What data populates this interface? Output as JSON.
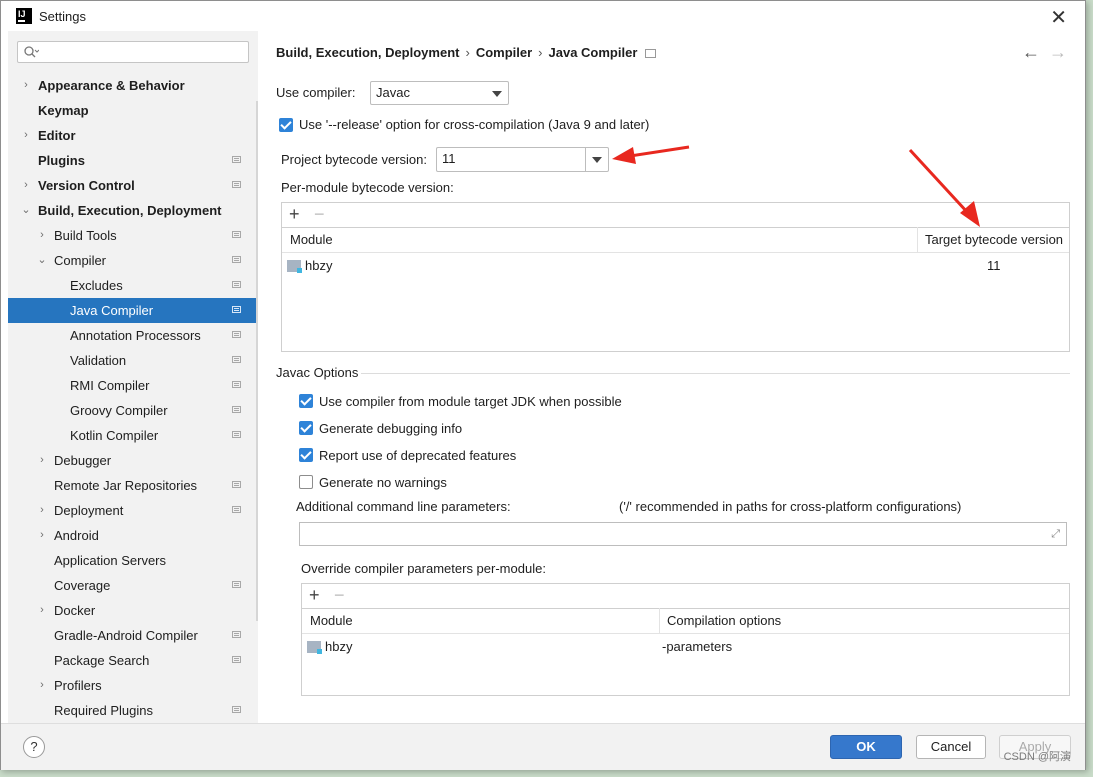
{
  "window": {
    "title": "Settings"
  },
  "sidebar": {
    "search_placeholder": "",
    "items": [
      {
        "label": "Appearance & Behavior",
        "bold": true,
        "arrow": "right",
        "indent": 0,
        "proj": false
      },
      {
        "label": "Keymap",
        "bold": true,
        "arrow": "",
        "indent": 0,
        "proj": false
      },
      {
        "label": "Editor",
        "bold": true,
        "arrow": "right",
        "indent": 0,
        "proj": false
      },
      {
        "label": "Plugins",
        "bold": true,
        "arrow": "",
        "indent": 0,
        "proj": true
      },
      {
        "label": "Version Control",
        "bold": true,
        "arrow": "right",
        "indent": 0,
        "proj": true
      },
      {
        "label": "Build, Execution, Deployment",
        "bold": true,
        "arrow": "down",
        "indent": 0,
        "proj": false
      },
      {
        "label": "Build Tools",
        "bold": false,
        "arrow": "right",
        "indent": 1,
        "proj": true
      },
      {
        "label": "Compiler",
        "bold": false,
        "arrow": "down",
        "indent": 1,
        "proj": true
      },
      {
        "label": "Excludes",
        "bold": false,
        "arrow": "",
        "indent": 2,
        "proj": true
      },
      {
        "label": "Java Compiler",
        "bold": false,
        "arrow": "",
        "indent": 2,
        "proj": true,
        "selected": true
      },
      {
        "label": "Annotation Processors",
        "bold": false,
        "arrow": "",
        "indent": 2,
        "proj": true
      },
      {
        "label": "Validation",
        "bold": false,
        "arrow": "",
        "indent": 2,
        "proj": true
      },
      {
        "label": "RMI Compiler",
        "bold": false,
        "arrow": "",
        "indent": 2,
        "proj": true
      },
      {
        "label": "Groovy Compiler",
        "bold": false,
        "arrow": "",
        "indent": 2,
        "proj": true
      },
      {
        "label": "Kotlin Compiler",
        "bold": false,
        "arrow": "",
        "indent": 2,
        "proj": true
      },
      {
        "label": "Debugger",
        "bold": false,
        "arrow": "right",
        "indent": 1,
        "proj": false
      },
      {
        "label": "Remote Jar Repositories",
        "bold": false,
        "arrow": "",
        "indent": 1,
        "proj": true
      },
      {
        "label": "Deployment",
        "bold": false,
        "arrow": "right",
        "indent": 1,
        "proj": true
      },
      {
        "label": "Android",
        "bold": false,
        "arrow": "right",
        "indent": 1,
        "proj": false
      },
      {
        "label": "Application Servers",
        "bold": false,
        "arrow": "",
        "indent": 1,
        "proj": false
      },
      {
        "label": "Coverage",
        "bold": false,
        "arrow": "",
        "indent": 1,
        "proj": true
      },
      {
        "label": "Docker",
        "bold": false,
        "arrow": "right",
        "indent": 1,
        "proj": false
      },
      {
        "label": "Gradle-Android Compiler",
        "bold": false,
        "arrow": "",
        "indent": 1,
        "proj": true
      },
      {
        "label": "Package Search",
        "bold": false,
        "arrow": "",
        "indent": 1,
        "proj": true
      },
      {
        "label": "Profilers",
        "bold": false,
        "arrow": "right",
        "indent": 1,
        "proj": false
      },
      {
        "label": "Required Plugins",
        "bold": false,
        "arrow": "",
        "indent": 1,
        "proj": true
      }
    ]
  },
  "breadcrumb": [
    "Build, Execution, Deployment",
    "Compiler",
    "Java Compiler"
  ],
  "main": {
    "use_compiler_label": "Use compiler:",
    "use_compiler_value": "Javac",
    "release_option_label": "Use '--release' option for cross-compilation (Java 9 and later)",
    "project_bytecode_label": "Project bytecode version:",
    "project_bytecode_value": "11",
    "per_module_label": "Per-module bytecode version:",
    "module_table": {
      "col_module": "Module",
      "col_target": "Target bytecode version",
      "rows": [
        {
          "module": "hbzy",
          "target": "11"
        }
      ]
    },
    "javac_options_label": "Javac Options",
    "opt_module_jdk": "Use compiler from module target JDK when possible",
    "opt_debug": "Generate debugging info",
    "opt_deprecated": "Report use of deprecated features",
    "opt_nowarn": "Generate no warnings",
    "additional_params_label": "Additional command line parameters:",
    "additional_params_hint": "('/' recommended in paths for cross-platform configurations)",
    "additional_params_value": "",
    "override_label": "Override compiler parameters per-module:",
    "override_table": {
      "col_module": "Module",
      "col_options": "Compilation options",
      "rows": [
        {
          "module": "hbzy",
          "options": "-parameters"
        }
      ]
    }
  },
  "footer": {
    "ok": "OK",
    "cancel": "Cancel",
    "apply": "Apply",
    "help": "?"
  },
  "watermark": "CSDN @阿演",
  "colors": {
    "accent": "#2675bf",
    "ok_button": "#3678cc",
    "arrow_annotation": "#e8281f"
  }
}
